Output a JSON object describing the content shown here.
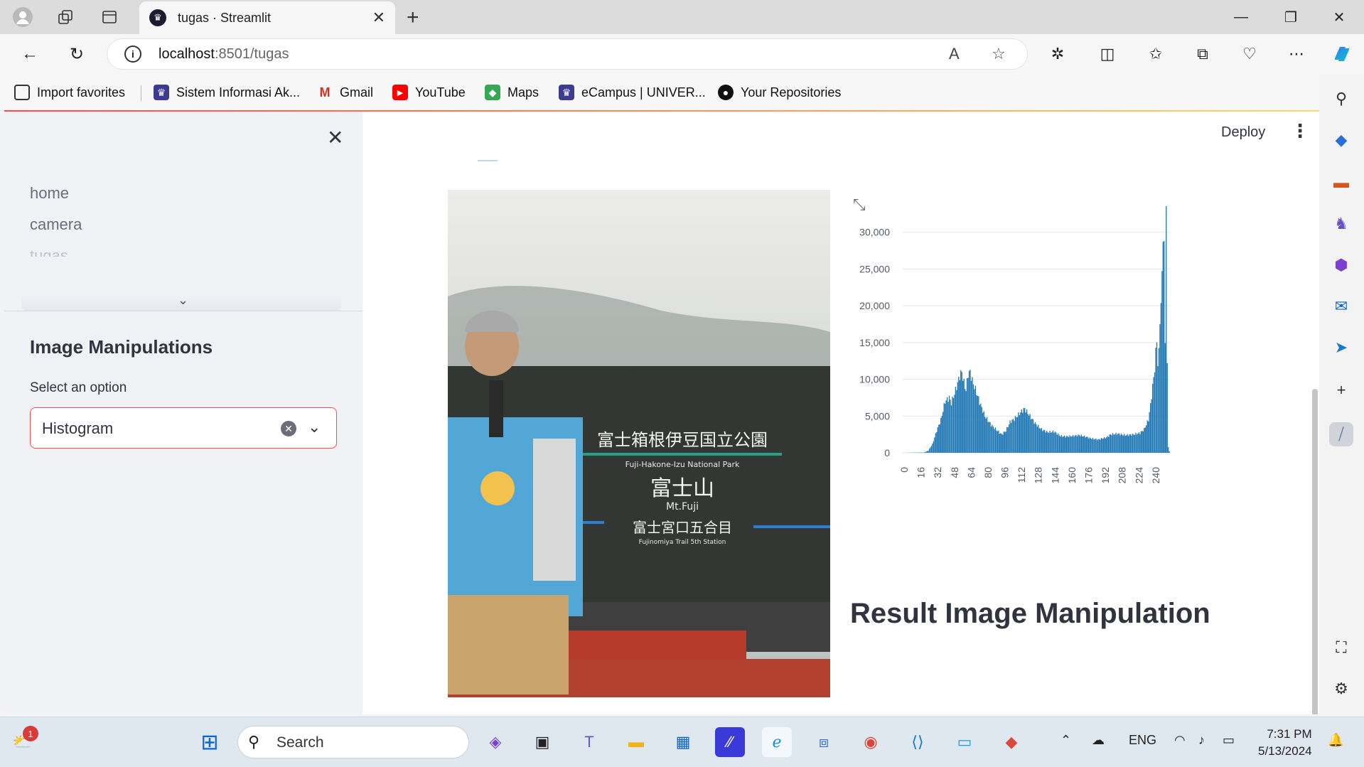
{
  "browser": {
    "tab_title": "tugas · Streamlit",
    "url_host": "localhost",
    "url_path": ":8501/tugas",
    "favorites": [
      {
        "label": "Import favorites",
        "icon": "import-icon",
        "color": "#333333"
      },
      {
        "label": "Sistem Informasi Ak...",
        "icon": "university-icon",
        "color": "#3b3b8f"
      },
      {
        "label": "Gmail",
        "icon": "gmail-icon",
        "color": "#d93025"
      },
      {
        "label": "YouTube",
        "icon": "youtube-icon",
        "color": "#ff0000"
      },
      {
        "label": "Maps",
        "icon": "maps-icon",
        "color": "#34a853"
      },
      {
        "label": "eCampus | UNIVER...",
        "icon": "university-icon",
        "color": "#3b3b8f"
      },
      {
        "label": "Your Repositories",
        "icon": "github-icon",
        "color": "#111111"
      }
    ]
  },
  "sidebar": {
    "nav": [
      "home",
      "camera",
      "tugas"
    ],
    "heading": "Image Manipulations",
    "select_label": "Select an option",
    "select_value": "Histogram"
  },
  "header": {
    "deploy": "Deploy"
  },
  "main": {
    "result_heading": "Result Image Manipulation"
  },
  "chart_data": {
    "type": "bar",
    "title": "",
    "xlabel": "",
    "ylabel": "",
    "x_ticks": [
      0,
      16,
      32,
      48,
      64,
      80,
      96,
      112,
      128,
      144,
      160,
      176,
      192,
      208,
      224,
      240
    ],
    "y_ticks": [
      "0",
      "5,000",
      "10,000",
      "15,000",
      "20,000",
      "25,000",
      "30,000"
    ],
    "ylim": [
      0,
      35000
    ],
    "xlim": [
      0,
      255
    ],
    "grid": true,
    "color": "#1f77b4",
    "anchors": [
      [
        0,
        0
      ],
      [
        20,
        50
      ],
      [
        24,
        300
      ],
      [
        28,
        1200
      ],
      [
        32,
        3000
      ],
      [
        36,
        4500
      ],
      [
        40,
        7000
      ],
      [
        44,
        7500
      ],
      [
        46,
        6800
      ],
      [
        50,
        8500
      ],
      [
        54,
        10500
      ],
      [
        56,
        11000
      ],
      [
        58,
        9500
      ],
      [
        60,
        8500
      ],
      [
        62,
        10800
      ],
      [
        64,
        11000
      ],
      [
        66,
        9800
      ],
      [
        70,
        8200
      ],
      [
        74,
        6500
      ],
      [
        78,
        5000
      ],
      [
        84,
        3800
      ],
      [
        90,
        3000
      ],
      [
        94,
        2500
      ],
      [
        98,
        3000
      ],
      [
        102,
        4200
      ],
      [
        106,
        4600
      ],
      [
        110,
        5200
      ],
      [
        114,
        5800
      ],
      [
        116,
        6000
      ],
      [
        120,
        5200
      ],
      [
        126,
        4000
      ],
      [
        132,
        3200
      ],
      [
        138,
        2800
      ],
      [
        144,
        2900
      ],
      [
        150,
        2300
      ],
      [
        156,
        2200
      ],
      [
        162,
        2300
      ],
      [
        168,
        2400
      ],
      [
        174,
        2200
      ],
      [
        178,
        2000
      ],
      [
        186,
        1800
      ],
      [
        194,
        2100
      ],
      [
        198,
        2500
      ],
      [
        204,
        2600
      ],
      [
        212,
        2400
      ],
      [
        220,
        2500
      ],
      [
        226,
        2700
      ],
      [
        230,
        3200
      ],
      [
        234,
        4500
      ],
      [
        236,
        6500
      ],
      [
        238,
        9000
      ],
      [
        240,
        11500
      ],
      [
        242,
        15500
      ],
      [
        243,
        12000
      ],
      [
        244,
        13500
      ],
      [
        245,
        18500
      ],
      [
        246,
        20000
      ],
      [
        247,
        24000
      ],
      [
        248,
        30500
      ],
      [
        249,
        27500
      ],
      [
        250,
        15000
      ],
      [
        251,
        35000
      ],
      [
        252,
        11500
      ],
      [
        253,
        800
      ],
      [
        254,
        200
      ],
      [
        255,
        0
      ]
    ]
  }
}
